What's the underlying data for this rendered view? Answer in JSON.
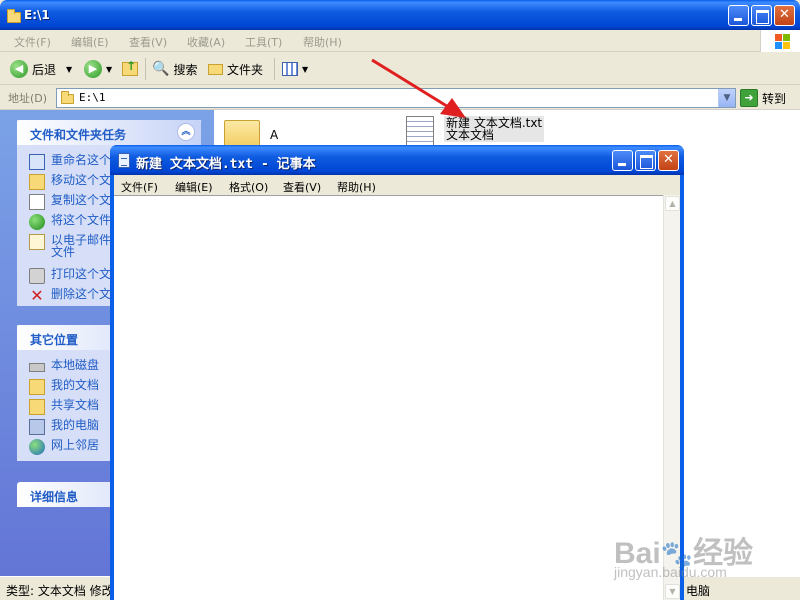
{
  "explorer": {
    "title": "E:\\1",
    "menu": [
      "文件(F)",
      "编辑(E)",
      "查看(V)",
      "收藏(A)",
      "工具(T)",
      "帮助(H)"
    ],
    "toolbar": {
      "back": "后退",
      "search": "搜索",
      "folders": "文件夹"
    },
    "address": {
      "label": "地址(D)",
      "value": "E:\\1",
      "go": "转到"
    },
    "task_pane": {
      "file_tasks": {
        "heading": "文件和文件夹任务",
        "items": [
          "重命名这个文",
          "移动这个文",
          "复制这个文",
          "将这个文件",
          "以电子邮件",
          "文件",
          "打印这个文",
          "删除这个文"
        ]
      },
      "other_places": {
        "heading": "其它位置",
        "items": [
          "本地磁盘",
          "我的文档",
          "共享文档",
          "我的电脑",
          "网上邻居"
        ]
      },
      "details": {
        "heading": "详细信息"
      }
    },
    "files": [
      {
        "name": "A",
        "icon": "folder-icon"
      },
      {
        "name": "新建 文本文档.txt",
        "type": "文本文档",
        "icon": "text-file-icon"
      }
    ],
    "status": {
      "left": "类型: 文本文档 修改",
      "right": "电脑"
    }
  },
  "notepad": {
    "title": "新建 文本文档.txt - 记事本",
    "menu": [
      "文件(F)",
      "编辑(E)",
      "格式(O)",
      "查看(V)",
      "帮助(H)"
    ],
    "content": ""
  },
  "watermark": {
    "brand": "Bai",
    "brand2": "经验",
    "url": "jingyan.baidu.com"
  },
  "colors": {
    "title_blue": "#0046D5",
    "link_blue": "#215DC6",
    "arrow_red": "#E02020"
  }
}
